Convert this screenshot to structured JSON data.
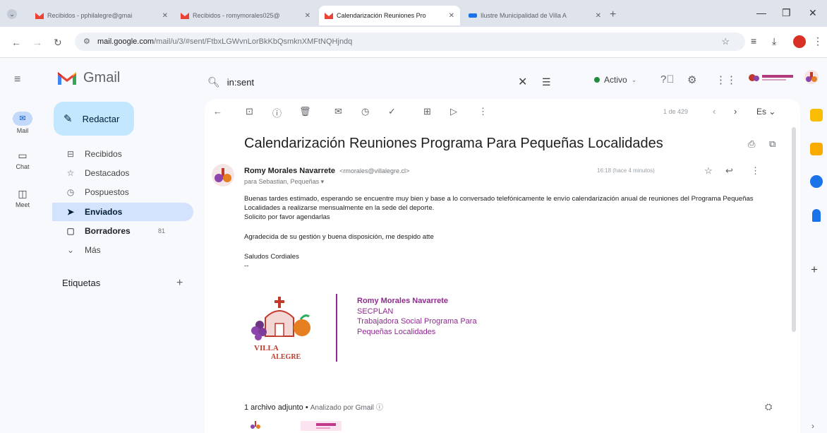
{
  "browser": {
    "tabs": [
      {
        "title": "Recibidos - pphilalegre@gmai",
        "active": false
      },
      {
        "title": "Recibidos - romymorales025@",
        "active": false
      },
      {
        "title": "Calendarización Reuniones Pro",
        "active": true
      },
      {
        "title": "Ilustre Municipalidad de Villa A",
        "active": false
      }
    ],
    "url_host": "mail.google.com",
    "url_path": "/mail/u/3/#sent/FtbxLGWvnLorBkKbQsmknXMFtNQHjndq"
  },
  "gmail": {
    "app_name": "Gmail",
    "search_value": "in:sent",
    "status": "Activo",
    "status_color": "#1e8e3e"
  },
  "rail": [
    {
      "label": "Mail",
      "icon": "mail-icon"
    },
    {
      "label": "Chat",
      "icon": "chat-icon"
    },
    {
      "label": "Meet",
      "icon": "meet-icon"
    }
  ],
  "sidebar": {
    "compose": "Redactar",
    "items": [
      {
        "label": "Recibidos",
        "icon": "inbox-icon",
        "count": ""
      },
      {
        "label": "Destacados",
        "icon": "star-icon",
        "count": ""
      },
      {
        "label": "Pospuestos",
        "icon": "clock-icon",
        "count": ""
      },
      {
        "label": "Enviados",
        "icon": "send-icon",
        "count": ""
      },
      {
        "label": "Borradores",
        "icon": "draft-icon",
        "count": "81"
      },
      {
        "label": "Más",
        "icon": "chevron-down-icon",
        "count": ""
      }
    ],
    "labels_heading": "Etiquetas"
  },
  "toolbar": {
    "pager": "1 de 429",
    "lang": "Es"
  },
  "email": {
    "subject": "Calendarización Reuniones Programa Para Pequeñas Localidades",
    "sender_name": "Romy Morales Navarrete",
    "sender_email": "<rmorales@villalegre.cl>",
    "recipients": "para Sebastian, Pequeñas",
    "time": "16:18 (hace 4 minutos)",
    "body": [
      "Buenas tardes estimado, esperando se encuentre muy bien y base a lo conversado telefónicamente  le envío calendarización anual de reuniones del Programa Pequeñas Localidades a realizarse mensualmente en la sede del deporte.",
      "Solicito por favor agendarlas",
      "",
      "Agradecida de su gestión y buena disposición, me despido atte",
      "",
      "Saludos Cordiales",
      "--"
    ],
    "signature": {
      "name": "Romy Morales Navarrete",
      "dept": "SECPLAN",
      "role1": "Trabajadora Social Programa Para",
      "role2": "Pequeñas Localidades",
      "color": "#8e2b8e"
    },
    "attachments_label": "1 archivo adjunto",
    "scanned": "Analizado por Gmail"
  },
  "logo_text": {
    "main": "VILLA",
    "sub": "ALEGRE"
  }
}
